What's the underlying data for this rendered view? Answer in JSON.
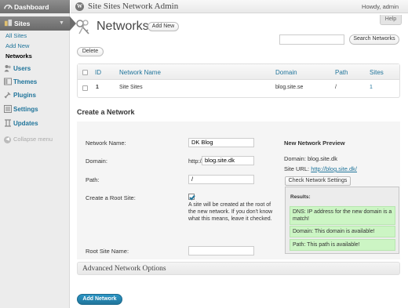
{
  "sidebar": {
    "dashboard": "Dashboard",
    "sites": "Sites",
    "sites_sub": [
      "All Sites",
      "Add New",
      "Networks"
    ],
    "items": [
      {
        "label": "Users",
        "icon": "users-icon"
      },
      {
        "label": "Themes",
        "icon": "themes-icon"
      },
      {
        "label": "Plugins",
        "icon": "plugins-icon"
      },
      {
        "label": "Settings",
        "icon": "settings-icon"
      },
      {
        "label": "Updates",
        "icon": "updates-icon"
      }
    ],
    "collapse": "Collapse menu"
  },
  "header": {
    "site_title": "Site Sites Network Admin",
    "howdy": "Howdy, admin",
    "help": "Help"
  },
  "page": {
    "title": "Networks",
    "add_new": "Add New",
    "search_button": "Search Networks",
    "search_placeholder": "",
    "delete": "Delete"
  },
  "table": {
    "columns": [
      "ID",
      "Network Name",
      "Domain",
      "Path",
      "Sites"
    ],
    "rows": [
      {
        "id": "1",
        "name": "Site Sites",
        "domain": "blog.site.se",
        "path": "/",
        "sites": "1"
      }
    ]
  },
  "form": {
    "section_title": "Create a Network",
    "network_name_label": "Network Name:",
    "network_name_value": "DK Blog",
    "domain_label": "Domain:",
    "domain_prefix": "http://",
    "domain_value": "blog.site.dk",
    "path_label": "Path:",
    "path_value": "/",
    "root_site_label": "Create a Root Site:",
    "root_site_note": "A site will be created at the root of the new network. If you don't know what this means, leave it checked.",
    "root_site_name_label": "Root Site Name:",
    "root_site_name_value": ""
  },
  "preview": {
    "title": "New Network Preview",
    "domain_text": "Domain: blog.site.dk",
    "site_url_label": "Site URL:",
    "site_url": "http://blog.site.dk/",
    "check_button": "Check Network Settings",
    "results_title": "Results:",
    "results": [
      "DNS: IP address for the new domain is a match!",
      "Domain: This domain is available!",
      "Path: This path is available!"
    ]
  },
  "advanced": "Advanced Network Options",
  "submit": "Add Network",
  "colors": {
    "link": "#21759b",
    "primary": "#21759b",
    "success_bg": "#ccf5c4"
  }
}
